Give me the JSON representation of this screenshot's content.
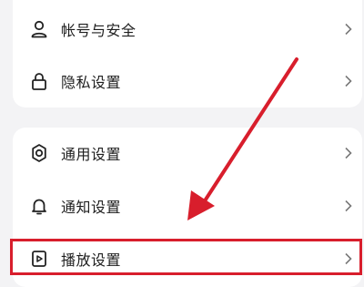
{
  "settings": {
    "groups": [
      {
        "items": [
          {
            "label": "帐号与安全",
            "icon": "person-icon"
          },
          {
            "label": "隐私设置",
            "icon": "lock-icon"
          }
        ]
      },
      {
        "items": [
          {
            "label": "通用设置",
            "icon": "gear-icon"
          },
          {
            "label": "通知设置",
            "icon": "bell-icon"
          },
          {
            "label": "播放设置",
            "icon": "play-icon"
          }
        ]
      }
    ]
  },
  "annotation": {
    "color": "#d81e2c",
    "highlighted_item": "播放设置"
  }
}
